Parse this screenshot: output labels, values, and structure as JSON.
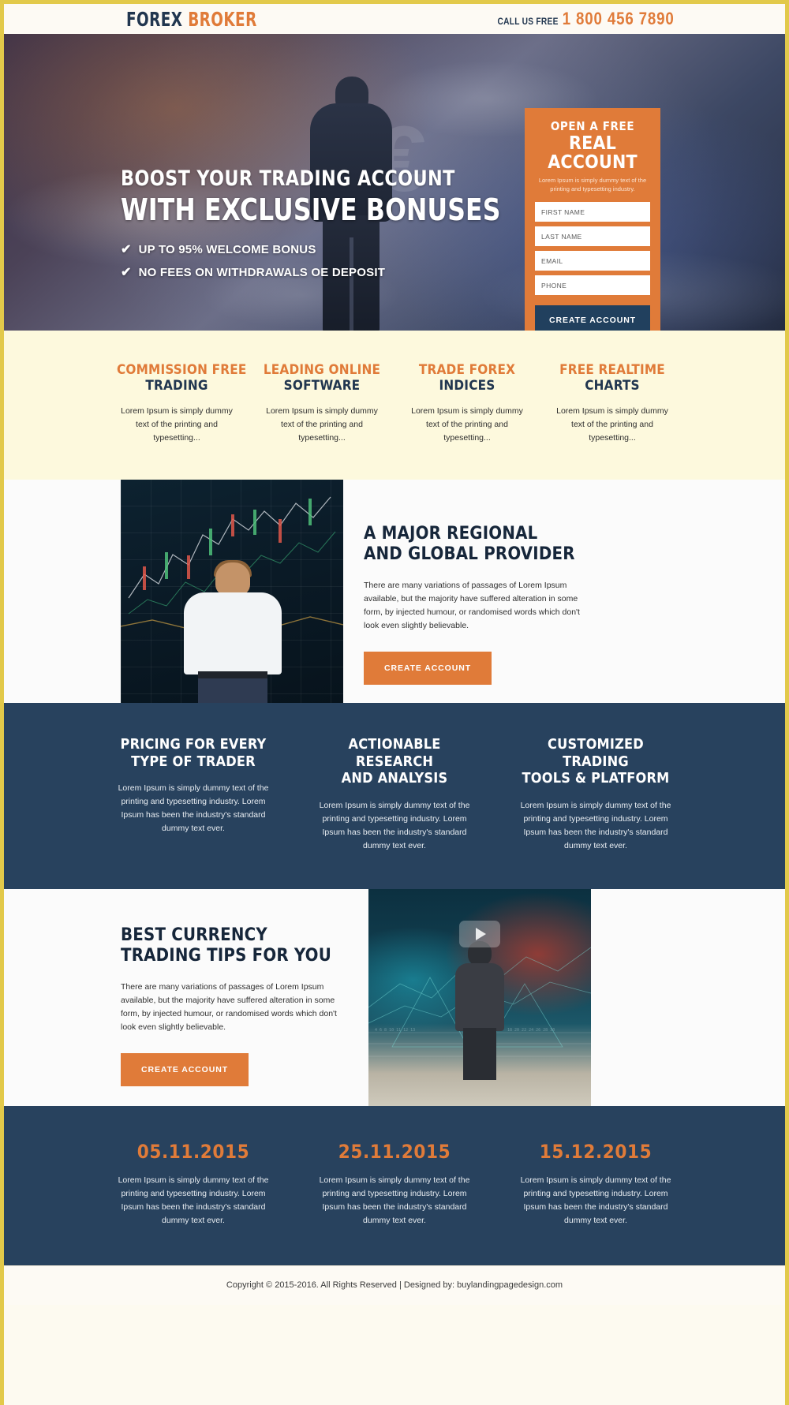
{
  "header": {
    "logo_primary": "FOREX",
    "logo_secondary": "BROKER",
    "call_label": "CALL US FREE",
    "phone": "1 800 456 7890"
  },
  "hero": {
    "headline_line1": "BOOST YOUR TRADING ACCOUNT",
    "headline_line2": "WITH EXCLUSIVE BONUSES",
    "check_icon": "check-mark",
    "bullets": [
      "UP TO 95% WELCOME BONUS",
      "NO FEES ON WITHDRAWALS OE DEPOSIT"
    ]
  },
  "form": {
    "title_line1": "OPEN A FREE",
    "title_line2": "REAL ACCOUNT",
    "subtitle": "Lorem Ipsum is simply dummy text of the printing and typesetting industry.",
    "fields": [
      {
        "name": "first-name",
        "placeholder": "FIRST NAME",
        "value": ""
      },
      {
        "name": "last-name",
        "placeholder": "LAST NAME",
        "value": ""
      },
      {
        "name": "email",
        "placeholder": "EMAIL",
        "value": ""
      },
      {
        "name": "phone",
        "placeholder": "PHONE",
        "value": ""
      }
    ],
    "submit_label": "CREATE ACCOUNT"
  },
  "features": [
    {
      "line1": "COMMISSION FREE",
      "line2": "TRADING",
      "text": "Lorem Ipsum is simply dummy text of the printing and typesetting..."
    },
    {
      "line1": "LEADING ONLINE",
      "line2": "SOFTWARE",
      "text": "Lorem Ipsum is simply dummy text of the printing and typesetting..."
    },
    {
      "line1": "TRADE FOREX",
      "line2": "INDICES",
      "text": "Lorem Ipsum is simply dummy text of the printing and typesetting..."
    },
    {
      "line1": "FREE REALTIME",
      "line2": "CHARTS",
      "text": "Lorem Ipsum is simply dummy text of the printing and typesetting..."
    }
  ],
  "section_provider": {
    "heading_line1": "A MAJOR REGIONAL",
    "heading_line2": "AND GLOBAL PROVIDER",
    "paragraph": "There are many variations of passages of Lorem Ipsum available, but the majority have suffered alteration in some form, by injected humour, or randomised words which don't look even slightly believable.",
    "button_label": "CREATE ACCOUNT"
  },
  "navy_columns": [
    {
      "heading_line1": "PRICING FOR EVERY",
      "heading_line2": "TYPE OF TRADER",
      "text": "Lorem Ipsum is simply dummy text of the printing and typesetting industry. Lorem Ipsum has been the industry's standard dummy text ever."
    },
    {
      "heading_line1": "ACTIONABLE RESEARCH",
      "heading_line2": "AND ANALYSIS",
      "text": "Lorem Ipsum is simply dummy text of the printing and typesetting industry. Lorem Ipsum has been the industry's standard dummy text ever."
    },
    {
      "heading_line1": "CUSTOMIZED TRADING",
      "heading_line2": "TOOLS & PLATFORM",
      "text": "Lorem Ipsum is simply dummy text of the printing and typesetting industry. Lorem Ipsum has been the industry's standard dummy text ever."
    }
  ],
  "section_tips": {
    "heading_line1": "BEST CURRENCY",
    "heading_line2": "TRADING TIPS FOR YOU",
    "paragraph": "There are many variations of passages of Lorem Ipsum available, but the majority have suffered alteration in some form, by injected humour, or randomised words which don't look even slightly believable.",
    "button_label": "CREATE ACCOUNT",
    "play_icon": "play-icon"
  },
  "dates": [
    {
      "date": "05.11.2015",
      "text": "Lorem Ipsum is simply dummy text of the printing and typesetting industry. Lorem Ipsum has been the industry's standard dummy text ever."
    },
    {
      "date": "25.11.2015",
      "text": "Lorem Ipsum is simply dummy text of the printing and typesetting industry. Lorem Ipsum has been the industry's standard dummy text ever."
    },
    {
      "date": "15.12.2015",
      "text": "Lorem Ipsum is simply dummy text of the printing and typesetting industry. Lorem Ipsum has been the industry's standard dummy text ever."
    }
  ],
  "footer": {
    "text": "Copyright © 2015-2016. All Rights Reserved  |  Designed by: buylandingpagedesign.com"
  },
  "colors": {
    "accent_orange": "#e07b39",
    "navy": "#28425e",
    "dark_navy": "#21364f",
    "cream": "#fdf9dd",
    "border_gold": "#e2c94a"
  }
}
